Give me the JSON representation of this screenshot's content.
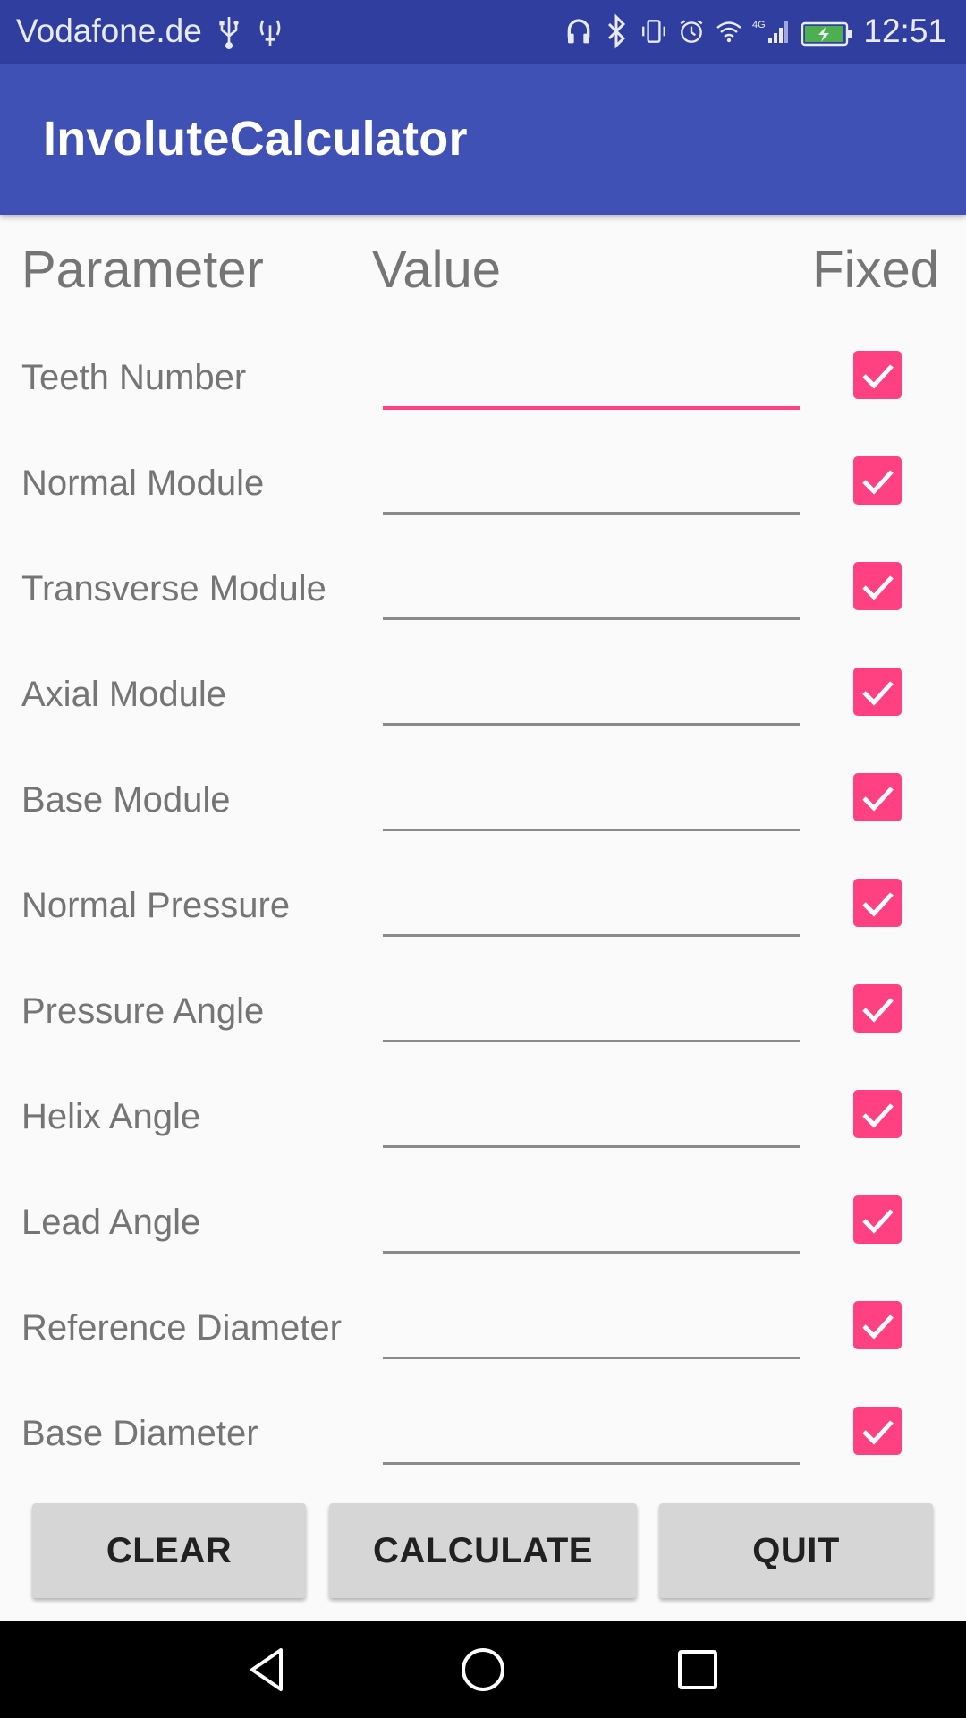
{
  "status_bar": {
    "carrier": "Vodafone.de",
    "network_label": "4G",
    "time": "12:51",
    "icons": [
      "usb-icon",
      "wifi-ap-icon",
      "headset-icon",
      "bluetooth-icon",
      "vibrate-icon",
      "alarm-icon",
      "wifi-icon",
      "signal-icon",
      "battery-charging-icon"
    ]
  },
  "app_bar": {
    "title": "InvoluteCalculator",
    "color": "#3f51b5"
  },
  "table": {
    "header": {
      "parameter": "Parameter",
      "value": "Value",
      "fixed": "Fixed"
    },
    "rows": [
      {
        "label": "Teeth Number",
        "value": "",
        "fixed": true
      },
      {
        "label": "Normal Module",
        "value": "",
        "fixed": true
      },
      {
        "label": "Transverse Module",
        "value": "",
        "fixed": true
      },
      {
        "label": "Axial Module",
        "value": "",
        "fixed": true
      },
      {
        "label": "Base Module",
        "value": "",
        "fixed": true
      },
      {
        "label": "Normal Pressure",
        "value": "",
        "fixed": true
      },
      {
        "label": "Pressure Angle",
        "value": "",
        "fixed": true
      },
      {
        "label": "Helix Angle",
        "value": "",
        "fixed": true
      },
      {
        "label": "Lead Angle",
        "value": "",
        "fixed": true
      },
      {
        "label": "Reference Diameter",
        "value": "",
        "fixed": true
      },
      {
        "label": "Base Diameter",
        "value": "",
        "fixed": true
      }
    ]
  },
  "buttons": {
    "clear": "CLEAR",
    "calculate": "CALCULATE",
    "quit": "QUIT"
  },
  "colors": {
    "accent": "#ff4081",
    "primary": "#3f51b5",
    "primary_dark": "#303f9f"
  },
  "nav_bar": {
    "icons": [
      "back-icon",
      "home-icon",
      "recents-icon"
    ]
  }
}
